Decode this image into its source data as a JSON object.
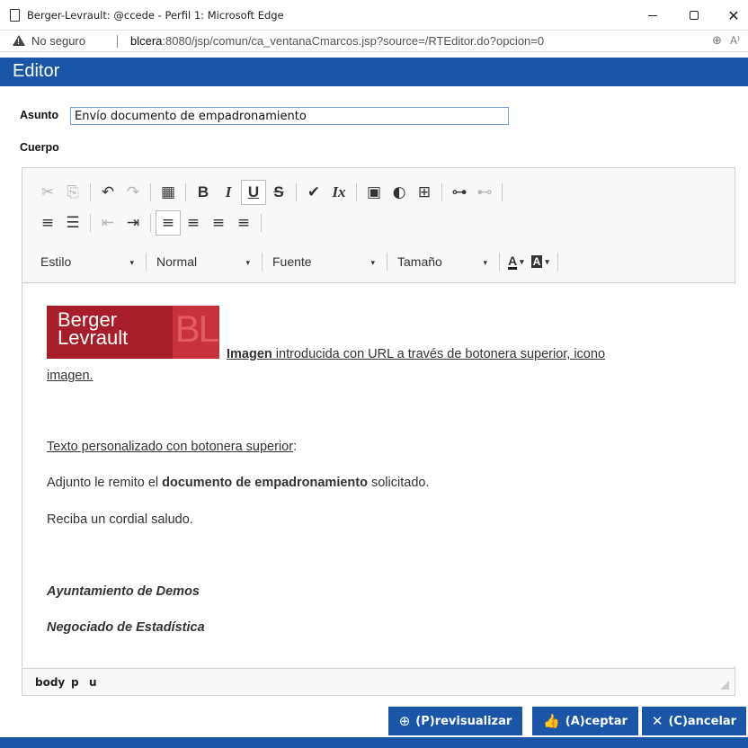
{
  "window": {
    "title": "Berger-Levrault: @ccede - Perfil 1: Microsoft Edge",
    "close_glyph": "✕"
  },
  "address_bar": {
    "security_label": "No seguro",
    "host": "blcera",
    "url_rest": ":8080/jsp/comun/ca_ventanaCmarcos.jsp?source=/RTEditor.do?opcion=0",
    "zoom_glyph": "⊕",
    "read_glyph": "A⁾"
  },
  "header": {
    "title": "Editor"
  },
  "form": {
    "asunto_label": "Asunto",
    "asunto_value": "Envío documento de empadronamiento",
    "cuerpo_label": "Cuerpo"
  },
  "toolbar": {
    "row1": [
      {
        "name": "cut-icon",
        "glyph": "✂",
        "state": "disabled"
      },
      {
        "name": "copy-icon",
        "glyph": "⎘",
        "state": "disabled"
      },
      {
        "name": "undo-icon",
        "glyph": "↶",
        "state": "normal"
      },
      {
        "name": "redo-icon",
        "glyph": "↷",
        "state": "disabled"
      },
      {
        "name": "format-painter-icon",
        "glyph": "▦",
        "state": "normal"
      },
      {
        "name": "bold-icon",
        "glyph": "B",
        "state": "normal"
      },
      {
        "name": "italic-icon",
        "glyph": "I",
        "state": "normal"
      },
      {
        "name": "underline-icon",
        "glyph": "U",
        "state": "active"
      },
      {
        "name": "strikethrough-icon",
        "glyph": "S",
        "state": "normal"
      },
      {
        "name": "clear-format-brush-icon",
        "glyph": "✔",
        "state": "normal"
      },
      {
        "name": "remove-format-icon",
        "glyph": "Ix",
        "state": "normal"
      },
      {
        "name": "image-icon",
        "glyph": "▣",
        "state": "normal"
      },
      {
        "name": "flash-icon",
        "glyph": "◐",
        "state": "normal"
      },
      {
        "name": "table-icon",
        "glyph": "⊞",
        "state": "normal"
      },
      {
        "name": "link-icon",
        "glyph": "⊶",
        "state": "normal"
      },
      {
        "name": "unlink-icon",
        "glyph": "⊷",
        "state": "disabled"
      }
    ],
    "row2": [
      {
        "name": "numbered-list-icon",
        "glyph": "≡",
        "state": "normal"
      },
      {
        "name": "bulleted-list-icon",
        "glyph": "☰",
        "state": "normal"
      },
      {
        "name": "outdent-icon",
        "glyph": "⇤",
        "state": "disabled"
      },
      {
        "name": "indent-icon",
        "glyph": "⇥",
        "state": "normal"
      },
      {
        "name": "align-left-icon",
        "glyph": "≡",
        "state": "active"
      },
      {
        "name": "align-center-icon",
        "glyph": "≡",
        "state": "normal"
      },
      {
        "name": "align-right-icon",
        "glyph": "≡",
        "state": "normal"
      },
      {
        "name": "justify-icon",
        "glyph": "≡",
        "state": "normal"
      }
    ],
    "combos": {
      "style": "Estilo",
      "format": "Normal",
      "font": "Fuente",
      "size": "Tamaño",
      "arrow": "▾"
    },
    "text_color_label": "A",
    "bg_color_label": "A"
  },
  "content": {
    "logo_line1": "Berger",
    "logo_line2": "Levrault",
    "logo_mark": "BL",
    "image_caption_bold": "Imagen",
    "image_caption_rest": " introducida con URL a través de botonera superior, icono",
    "image_caption_line2": "imagen.",
    "custom_text_link": "Texto personalizado con botonera superior",
    "custom_text_colon": ":",
    "adjunto_before": "Adjunto le remito el ",
    "adjunto_bold": "documento de empadronamiento",
    "adjunto_after": " solicitado.",
    "saludo": "Reciba un cordial saludo.",
    "ayuntamiento": "Ayuntamiento de Demos",
    "negociado": "Negociado de Estadística"
  },
  "path": [
    "body",
    "p",
    "u"
  ],
  "actions": {
    "preview": "(P)revisualizar",
    "preview_icon": "⊕",
    "accept": "(A)ceptar",
    "accept_icon": "👍",
    "cancel": "(C)ancelar",
    "cancel_icon": "✕"
  }
}
